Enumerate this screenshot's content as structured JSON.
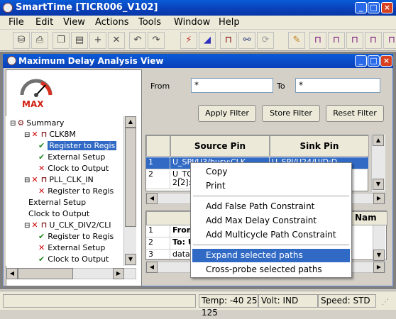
{
  "app": {
    "title": "SmartTime [TICR006_V102]"
  },
  "menu": [
    "File",
    "Edit",
    "View",
    "Actions",
    "Tools",
    "Window",
    "Help"
  ],
  "view": {
    "title": "Maximum Delay Analysis View"
  },
  "logo": {
    "label": "MAX"
  },
  "filter": {
    "from_label": "From",
    "from_value": "*",
    "to_label": "To",
    "to_value": "*",
    "apply": "Apply Filter",
    "store": "Store Filter",
    "reset": "Reset Filter"
  },
  "tree": [
    {
      "text": "Summary",
      "indent": 0,
      "mark": "none",
      "kind": "summary",
      "selected": false
    },
    {
      "text": "CLK8M",
      "indent": 1,
      "mark": "x",
      "kind": "clock",
      "selected": false
    },
    {
      "text": "Register to Regis",
      "indent": 2,
      "mark": "check",
      "kind": "item",
      "selected": true
    },
    {
      "text": "External Setup",
      "indent": 2,
      "mark": "check",
      "kind": "item",
      "selected": false
    },
    {
      "text": "Clock to Output",
      "indent": 2,
      "mark": "x",
      "kind": "item",
      "selected": false
    },
    {
      "text": "PLL_CLK_IN",
      "indent": 1,
      "mark": "x",
      "kind": "clock",
      "selected": false
    },
    {
      "text": "Register to Regis",
      "indent": 2,
      "mark": "x",
      "kind": "item",
      "selected": false
    },
    {
      "text": "External Setup",
      "indent": 1.3,
      "mark": "none",
      "kind": "item",
      "selected": false
    },
    {
      "text": "Clock to Output",
      "indent": 1.3,
      "mark": "none",
      "kind": "item",
      "selected": false
    },
    {
      "text": "U_CLK_DIV2/CLI",
      "indent": 1,
      "mark": "x",
      "kind": "clock",
      "selected": false
    },
    {
      "text": "Register to Regis",
      "indent": 2,
      "mark": "check",
      "kind": "item",
      "selected": false
    },
    {
      "text": "External Setup",
      "indent": 2,
      "mark": "x",
      "kind": "item",
      "selected": false
    },
    {
      "text": "Clock to Output",
      "indent": 2,
      "mark": "check",
      "kind": "item",
      "selected": false
    }
  ],
  "paths_table": {
    "headers": [
      "Source Pin",
      "Sink Pin"
    ],
    "rows": [
      {
        "num": "1",
        "source": "U_SPI/U3/busy:CLK",
        "sink": "U_SPI/U24/U/D:D"
      },
      {
        "num": "2",
        "source": "U_TO",
        "sink": "2[2]:C"
      }
    ]
  },
  "details_table": {
    "header_right": "Nam",
    "rows": [
      {
        "num": "1",
        "text": "From"
      },
      {
        "num": "2",
        "text": "To: U"
      },
      {
        "num": "3",
        "text": "data r"
      }
    ]
  },
  "context_menu": {
    "items": [
      {
        "label": "Copy",
        "selected": false
      },
      {
        "label": "Print",
        "selected": false
      },
      {
        "label": "Add False Path Constraint",
        "selected": false
      },
      {
        "label": "Add Max Delay Constraint",
        "selected": false
      },
      {
        "label": "Add Multicycle Path Constraint",
        "selected": false
      },
      {
        "label": "Expand selected paths",
        "selected": true
      },
      {
        "label": "Cross-probe selected paths",
        "selected": false
      }
    ]
  },
  "status": {
    "temp": "Temp: -40 25 125",
    "volt": "Volt: IND",
    "speed": "Speed: STD"
  }
}
